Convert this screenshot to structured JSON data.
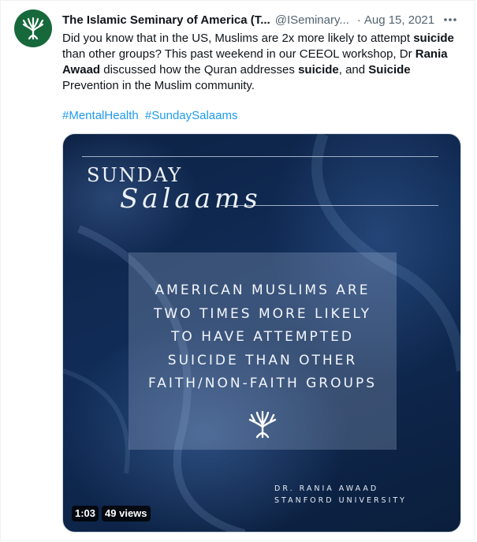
{
  "tweet": {
    "author_name": "The Islamic Seminary of America (T...",
    "author_handle": "@ISeminary...",
    "separator": "·",
    "date": "Aug 15, 2021",
    "more_icon": "more-dots-icon",
    "avatar_icon": "tree-logo-icon",
    "body": [
      {
        "text": "Did you know that in the US, Muslims are 2x more likely to attempt ",
        "bold": false
      },
      {
        "text": "suicide",
        "bold": true
      },
      {
        "text": " than other groups? This past weekend in our CEEOL workshop, Dr ",
        "bold": false
      },
      {
        "text": "Rania Awaad",
        "bold": true
      },
      {
        "text": " discussed how the Quran addresses ",
        "bold": false
      },
      {
        "text": "suicide",
        "bold": true
      },
      {
        "text": ", and ",
        "bold": false
      },
      {
        "text": "Suicide",
        "bold": true
      },
      {
        "text": " Prevention in the Muslim community.",
        "bold": false
      }
    ],
    "hashtags": [
      "#MentalHealth",
      "#SundaySalaams"
    ],
    "link_color": "#1d9bf0",
    "brand_color": "#17693c"
  },
  "media": {
    "title_line1": "SUNDAY",
    "title_line2": "Salaams",
    "quote_lines": [
      "AMERICAN MUSLIMS ARE",
      "TWO TIMES MORE LIKELY",
      "TO HAVE ATTEMPTED",
      "SUICIDE THAN OTHER",
      "FAITH/NON-FAITH GROUPS"
    ],
    "credit_name": "DR. RANIA AWAAD",
    "credit_affiliation": "STANFORD UNIVERSITY",
    "duration": "1:03",
    "views": "49 views",
    "background_color": "#102c57"
  }
}
